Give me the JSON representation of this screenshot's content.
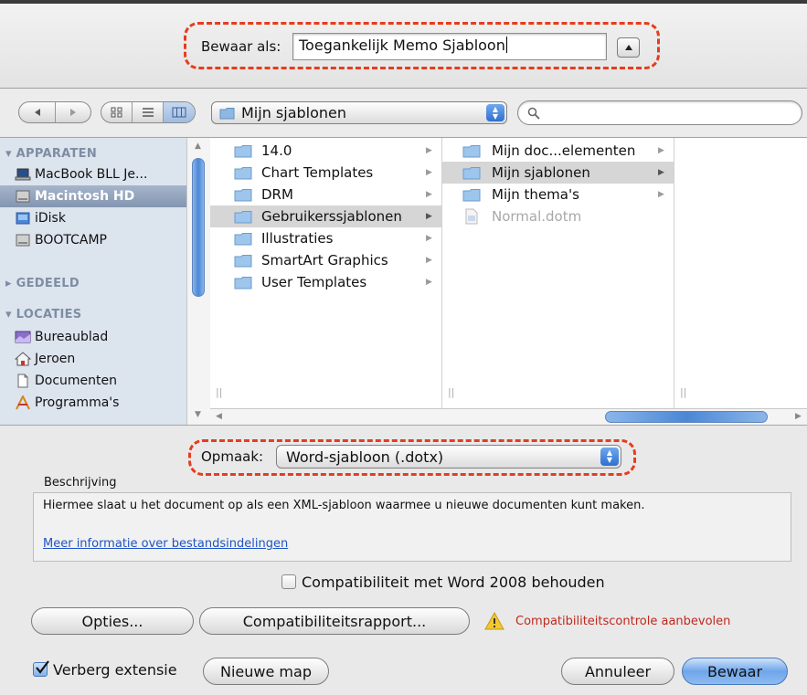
{
  "save_as": {
    "label": "Bewaar als:",
    "filename": "Toegankelijk Memo Sjabloon"
  },
  "toolbar": {
    "location": "Mijn sjablonen",
    "search_placeholder": ""
  },
  "sidebar": {
    "sections": [
      {
        "heading": "APPARATEN",
        "items": [
          {
            "label": "MacBook BLL Je...",
            "icon": "laptop-icon",
            "selected": false
          },
          {
            "label": "Macintosh HD",
            "icon": "hard-drive-icon",
            "selected": true
          },
          {
            "label": "iDisk",
            "icon": "idisk-icon",
            "selected": false
          },
          {
            "label": "BOOTCAMP",
            "icon": "hard-drive-icon",
            "selected": false
          }
        ]
      },
      {
        "heading": "GEDEELD",
        "items": []
      },
      {
        "heading": "LOCATIES",
        "items": [
          {
            "label": "Bureaublad",
            "icon": "desktop-icon",
            "selected": false
          },
          {
            "label": "Jeroen",
            "icon": "home-icon",
            "selected": false
          },
          {
            "label": "Documenten",
            "icon": "documents-icon",
            "selected": false
          },
          {
            "label": "Programma's",
            "icon": "applications-icon",
            "selected": false
          }
        ]
      }
    ]
  },
  "columns": [
    {
      "items": [
        {
          "label": "14.0",
          "type": "folder",
          "selected": false
        },
        {
          "label": "Chart Templates",
          "type": "folder",
          "selected": false
        },
        {
          "label": "DRM",
          "type": "folder",
          "selected": false
        },
        {
          "label": "Gebruikerssjablonen",
          "type": "folder",
          "selected": true
        },
        {
          "label": "Illustraties",
          "type": "folder",
          "selected": false
        },
        {
          "label": "SmartArt Graphics",
          "type": "folder",
          "selected": false
        },
        {
          "label": "User Templates",
          "type": "folder",
          "selected": false
        }
      ]
    },
    {
      "items": [
        {
          "label": "Mijn doc...elementen",
          "type": "folder",
          "selected": false
        },
        {
          "label": "Mijn sjablonen",
          "type": "folder",
          "selected": true
        },
        {
          "label": "Mijn thema's",
          "type": "folder",
          "selected": false
        },
        {
          "label": "Normal.dotm",
          "type": "file",
          "selected": false
        }
      ]
    }
  ],
  "format": {
    "label": "Opmaak:",
    "value": "Word-sjabloon (.dotx)"
  },
  "description": {
    "heading": "Beschrijving",
    "text": "Hiermee slaat u het document op als een XML-sjabloon waarmee u nieuwe documenten kunt maken.",
    "link": "Meer informatie over bestandsindelingen"
  },
  "compat_checkbox": {
    "label": "Compatibiliteit met Word 2008 behouden",
    "checked": false
  },
  "buttons": {
    "options": "Opties...",
    "compat_report": "Compatibiliteitsrapport...",
    "warning": "Compatibiliteitscontrole aanbevolen",
    "hide_ext": "Verberg extensie",
    "new_folder": "Nieuwe map",
    "cancel": "Annuleer",
    "save": "Bewaar"
  },
  "hide_extension_checked": true,
  "colors": {
    "highlight_dash": "#e53d1d",
    "warning_text": "#c0281e",
    "link": "#1d53c6"
  }
}
